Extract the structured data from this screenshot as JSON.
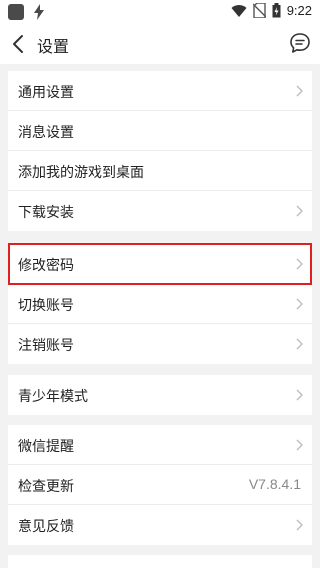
{
  "status_bar": {
    "time": "9:22",
    "icons": [
      "app-square-icon",
      "lightning-icon",
      "wifi-icon",
      "no-sim-icon",
      "battery-icon"
    ]
  },
  "header": {
    "title": "设置",
    "back_icon": "chevron-left-icon",
    "right_icon": "message-bubble-icon"
  },
  "groups": [
    {
      "items": [
        {
          "label": "通用设置",
          "chevron": true
        },
        {
          "label": "消息设置",
          "chevron": false
        },
        {
          "label": "添加我的游戏到桌面",
          "chevron": false
        },
        {
          "label": "下载安装",
          "chevron": true
        }
      ]
    },
    {
      "items": [
        {
          "label": "修改密码",
          "chevron": true,
          "highlighted": true
        },
        {
          "label": "切换账号",
          "chevron": true
        },
        {
          "label": "注销账号",
          "chevron": true
        }
      ]
    },
    {
      "items": [
        {
          "label": "青少年模式",
          "chevron": true
        }
      ]
    },
    {
      "items": [
        {
          "label": "微信提醒",
          "chevron": true
        },
        {
          "label": "检查更新",
          "value": "V7.8.4.1"
        },
        {
          "label": "意见反馈",
          "chevron": true
        }
      ]
    }
  ],
  "colors": {
    "background": "#f2f2f2",
    "card": "#ffffff",
    "highlight_border": "#e02020",
    "chevron": "#bbbbbb"
  }
}
